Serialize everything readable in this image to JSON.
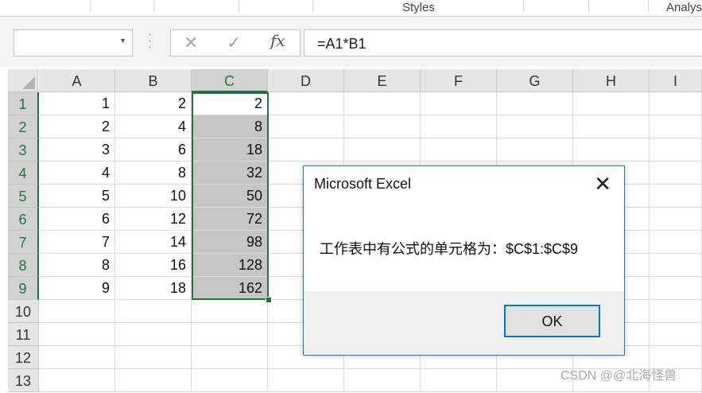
{
  "ribbon": {
    "groups": [
      "Styles",
      "Analys"
    ]
  },
  "formula_bar": {
    "name_box": "",
    "cancel_icon": "✕",
    "enter_icon": "✓",
    "fx_label": "fx",
    "formula": "=A1*B1"
  },
  "sheet": {
    "columns": [
      "A",
      "B",
      "C",
      "D",
      "E",
      "F",
      "G",
      "H",
      "I"
    ],
    "selected_column": "C",
    "rows": [
      "1",
      "2",
      "3",
      "4",
      "5",
      "6",
      "7",
      "8",
      "9",
      "10",
      "11",
      "12",
      "13"
    ],
    "data": [
      [
        "1",
        "2",
        "2"
      ],
      [
        "2",
        "4",
        "8"
      ],
      [
        "3",
        "6",
        "18"
      ],
      [
        "4",
        "8",
        "32"
      ],
      [
        "5",
        "10",
        "50"
      ],
      [
        "6",
        "12",
        "72"
      ],
      [
        "7",
        "14",
        "98"
      ],
      [
        "8",
        "16",
        "128"
      ],
      [
        "9",
        "18",
        "162"
      ]
    ],
    "selection": "C1:C9",
    "accent_color": "#217346"
  },
  "dialog": {
    "title": "Microsoft Excel",
    "close_icon": "✕",
    "message": "工作表中有公式的单元格为：$C$1:$C$9",
    "ok_label": "OK"
  },
  "watermark": "CSDN @@北海怪兽"
}
